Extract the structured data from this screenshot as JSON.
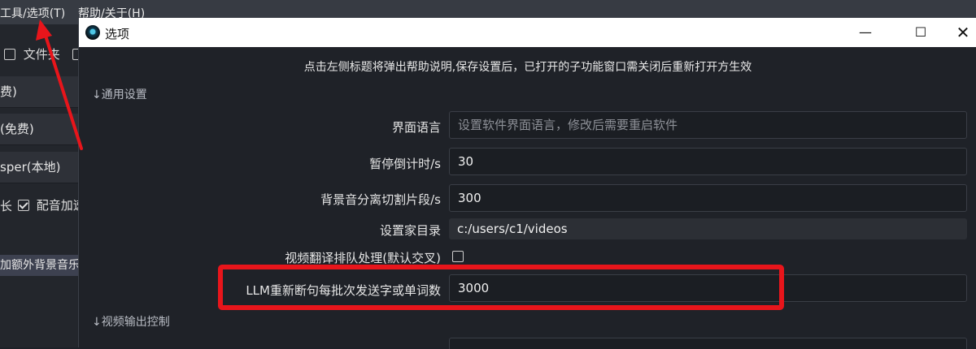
{
  "background_window": {
    "menu": {
      "tools": "工具/选项(T)",
      "help": "帮助/关于(H)"
    },
    "checkbox_subtitle": "文件夹",
    "select_1": "费)",
    "select_2": "(免费)",
    "select_3": "sper(本地)",
    "partial_text": "长",
    "dub_speedup_label": "配音加速",
    "extra_bgm_button": "加额外背景音乐"
  },
  "dialog": {
    "title": "选项",
    "minimize_glyph": "—",
    "maximize_glyph": "☐",
    "close_glyph": "✕",
    "hint": "点击左侧标题将弹出帮助说明,保存设置后，已打开的子功能窗口需关闭后重新打开方生效",
    "section_general": "↓通用设置",
    "fields": {
      "language_label": "界面语言",
      "language_placeholder": "设置软件界面语言，修改后需要重启软件",
      "countdown_label": "暂停倒计时/s",
      "countdown_value": "30",
      "bgm_segment_label": "背景音分离切割片段/s",
      "bgm_segment_value": "300",
      "home_dir_label": "设置家目录",
      "home_dir_value": "c:/users/c1/videos",
      "queue_label": "视频翻译排队处理(默认交叉)",
      "llm_batch_label": "LLM重新断句每批次发送字或单词数",
      "llm_batch_value": "3000"
    },
    "section_video_output": "↓视频输出控制"
  },
  "colors": {
    "highlight": "#e8151b",
    "dialog_bg": "#1f2228",
    "titlebar_bg": "#ffffff"
  }
}
